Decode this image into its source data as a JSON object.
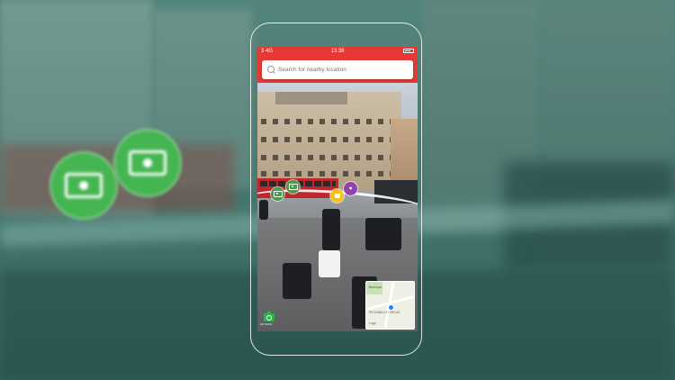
{
  "status_bar": {
    "signal": "3  4G",
    "time": "13:38"
  },
  "search": {
    "placeholder": "Search for nearby location"
  },
  "poi_markers": [
    {
      "icon": "cash-icon",
      "color": "#43a047"
    },
    {
      "icon": "cash-icon",
      "color": "#43a047"
    },
    {
      "icon": "coffee-icon",
      "color": "#f6c21b"
    },
    {
      "icon": "shopping-icon",
      "color": "#8e44ad"
    }
  ],
  "minimap": {
    "labels": [
      "Beenspa",
      "PICCADILLY CIRCUS",
      "Logo"
    ]
  },
  "camera_button": {
    "label": "AR SCAN"
  },
  "colors": {
    "accent": "#e53935",
    "poi_green": "#43a047",
    "poi_yellow": "#f6c21b",
    "poi_purple": "#8e44ad"
  }
}
